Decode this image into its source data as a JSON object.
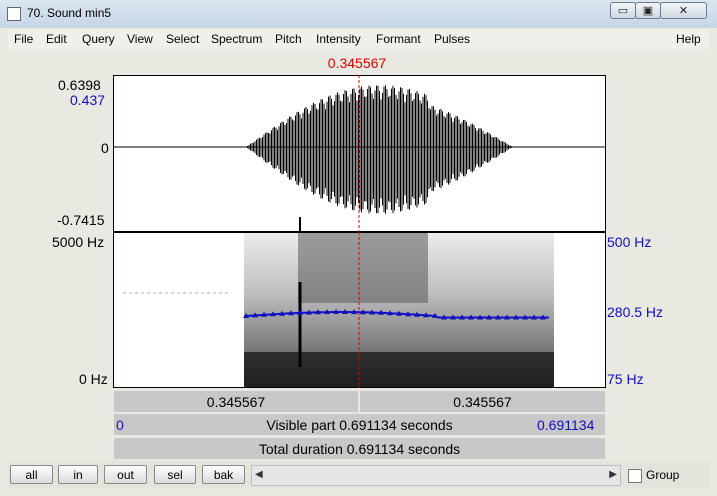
{
  "window": {
    "title": "70. Sound min5",
    "controls": {
      "minimize": "▭",
      "maximize": "▣",
      "close": "✕"
    }
  },
  "menu": {
    "items": [
      "File",
      "Edit",
      "Query",
      "View",
      "Select",
      "Spectrum",
      "Pitch",
      "Intensity",
      "Formant",
      "Pulses"
    ],
    "help": "Help"
  },
  "cursor": {
    "time_label": "0.345567",
    "time": 0.345567
  },
  "waveform": {
    "max_label": "0.6398",
    "level_label": "0.437",
    "zero_label": "0",
    "min_label": "-0.7415"
  },
  "spectrogram": {
    "top_freq_label": "5000 Hz",
    "bottom_freq_label": "0 Hz",
    "pitch_top_label": "500 Hz",
    "pitch_mid_label": "280.5 Hz",
    "pitch_bottom_label": "75 Hz"
  },
  "bars": {
    "left_time": "0.345567",
    "right_time": "0.345567",
    "visible_start": "0",
    "visible_part": "Visible part 0.691134 seconds",
    "visible_end": "0.691134",
    "total_duration": "Total duration 0.691134 seconds"
  },
  "buttons": {
    "all": "all",
    "in": "in",
    "out": "out",
    "sel": "sel",
    "bak": "bak"
  },
  "scroll": {
    "left_arrow": "◀",
    "right_arrow": "▶"
  },
  "group": {
    "label": "Group",
    "checked": false
  },
  "colors": {
    "cursor": "#dd0000",
    "pitch": "#1010c0",
    "accent": "#1010c0"
  }
}
